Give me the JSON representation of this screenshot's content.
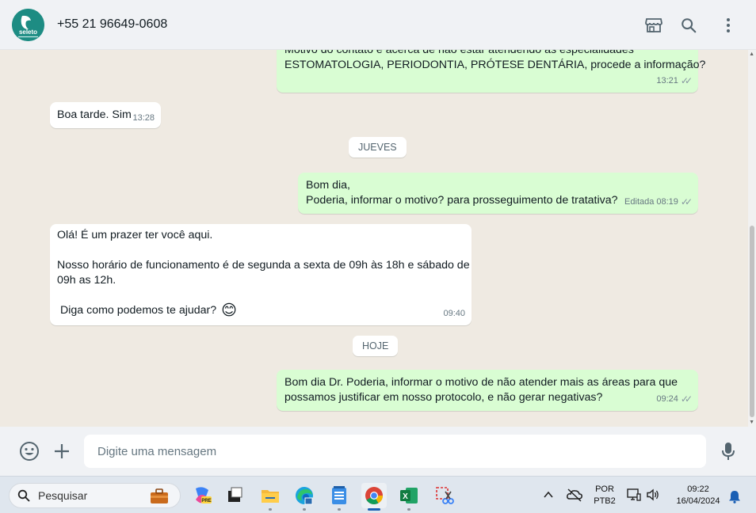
{
  "header": {
    "contact_name": "+55 21 96649-0608",
    "avatar_text": "seleto",
    "icons": [
      "shop-icon",
      "search-icon",
      "more-vertical-icon"
    ]
  },
  "messages": [
    {
      "direction": "out",
      "text_line1": "Motivo do contato é acerca de não estar atendendo as especialidades",
      "text_line2": "ESTOMATOLOGIA, PERIODONTIA, PRÓTESE DENTÁRIA, procede a informação?",
      "time": "13:21",
      "status": "read"
    },
    {
      "direction": "in",
      "text": "Boa tarde. Sim",
      "time": "13:28"
    },
    {
      "direction": "out",
      "text_line1": "Bom dia,",
      "text_line2": "Poderia, informar o motivo? para prosseguimento de tratativa?",
      "edited_label": "Editada",
      "time": "08:19",
      "status": "read"
    },
    {
      "direction": "in",
      "text_line1": "Olá! É um prazer ter você aqui.",
      "text_line2": "Nosso horário de funcionamento é de segunda a sexta de 09h às 18h e sábado de",
      "text_line3": "09h as 12h.",
      "text_line4": "Diga como podemos te ajudar?",
      "emoji": "😊",
      "time": "09:40"
    },
    {
      "direction": "out",
      "text_line1": "Bom dia Dr. Poderia, informar o motivo de não atender mais as áreas para que",
      "text_line2": "possamos justificar em nosso protocolo, e não gerar negativas?",
      "time": "09:24",
      "status": "read"
    }
  ],
  "date_dividers": {
    "jueves": "JUEVES",
    "hoje": "HOJE"
  },
  "composer": {
    "placeholder": "Digite uma mensagem",
    "icons": [
      "emoji-icon",
      "plus-icon",
      "microphone-icon"
    ]
  },
  "taskbar": {
    "search_label": "Pesquisar",
    "language_line1": "POR",
    "language_line2": "PTB2",
    "time": "09:22",
    "date": "16/04/2024"
  },
  "colors": {
    "outgoing_bubble": "#d9fdd3",
    "incoming_bubble": "#ffffff",
    "chat_background": "#efeae2",
    "header_background": "#f0f2f5"
  }
}
